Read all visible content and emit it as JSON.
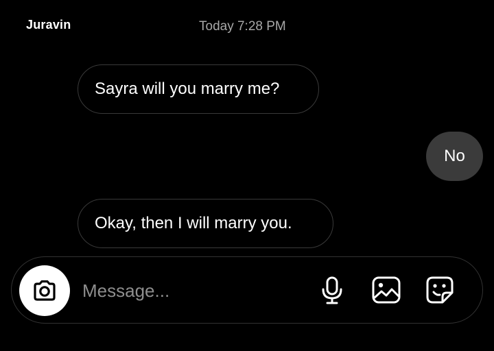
{
  "header": {
    "sender_name": "Juravin",
    "timestamp": "Today 7:28 PM"
  },
  "messages": [
    {
      "direction": "received",
      "text": "Sayra will you marry me?"
    },
    {
      "direction": "sent",
      "text": "No"
    },
    {
      "direction": "received",
      "text": "Okay, then I will marry you."
    }
  ],
  "composer": {
    "placeholder": "Message...",
    "value": "",
    "camera_icon": "camera-icon",
    "icons": [
      "microphone-icon",
      "image-gallery-icon",
      "sticker-icon"
    ]
  },
  "colors": {
    "background": "#000000",
    "received_bubble_border": "#3a3a3a",
    "sent_bubble_fill": "#3b3b3b",
    "timestamp": "#a8a8a8",
    "placeholder": "#8e8e8e"
  }
}
